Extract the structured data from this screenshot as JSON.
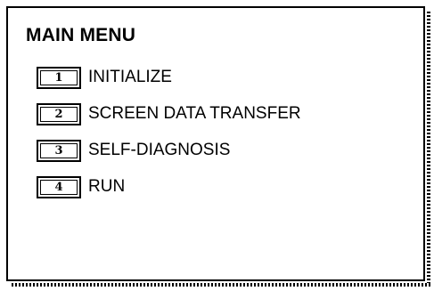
{
  "screen": {
    "title": "MAIN MENU"
  },
  "menu": {
    "items": [
      {
        "key": "1",
        "label": "INITIALIZE"
      },
      {
        "key": "2",
        "label": "SCREEN DATA TRANSFER"
      },
      {
        "key": "3",
        "label": "SELF-DIAGNOSIS"
      },
      {
        "key": "4",
        "label": "RUN"
      }
    ]
  },
  "colors": {
    "foreground": "#000000",
    "background": "#ffffff"
  }
}
